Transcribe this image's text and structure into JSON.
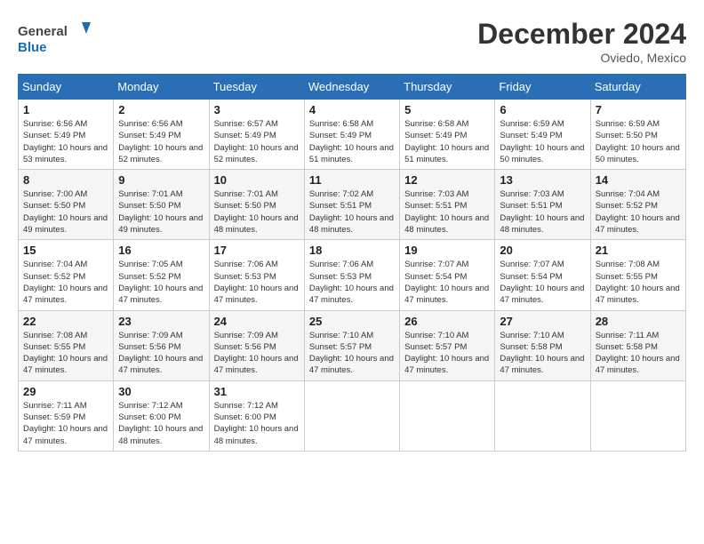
{
  "header": {
    "logo_line1": "General",
    "logo_line2": "Blue",
    "month": "December 2024",
    "location": "Oviedo, Mexico"
  },
  "weekdays": [
    "Sunday",
    "Monday",
    "Tuesday",
    "Wednesday",
    "Thursday",
    "Friday",
    "Saturday"
  ],
  "weeks": [
    [
      {
        "day": "1",
        "sunrise": "6:56 AM",
        "sunset": "5:49 PM",
        "daylight": "10 hours and 53 minutes."
      },
      {
        "day": "2",
        "sunrise": "6:56 AM",
        "sunset": "5:49 PM",
        "daylight": "10 hours and 52 minutes."
      },
      {
        "day": "3",
        "sunrise": "6:57 AM",
        "sunset": "5:49 PM",
        "daylight": "10 hours and 52 minutes."
      },
      {
        "day": "4",
        "sunrise": "6:58 AM",
        "sunset": "5:49 PM",
        "daylight": "10 hours and 51 minutes."
      },
      {
        "day": "5",
        "sunrise": "6:58 AM",
        "sunset": "5:49 PM",
        "daylight": "10 hours and 51 minutes."
      },
      {
        "day": "6",
        "sunrise": "6:59 AM",
        "sunset": "5:49 PM",
        "daylight": "10 hours and 50 minutes."
      },
      {
        "day": "7",
        "sunrise": "6:59 AM",
        "sunset": "5:50 PM",
        "daylight": "10 hours and 50 minutes."
      }
    ],
    [
      {
        "day": "8",
        "sunrise": "7:00 AM",
        "sunset": "5:50 PM",
        "daylight": "10 hours and 49 minutes."
      },
      {
        "day": "9",
        "sunrise": "7:01 AM",
        "sunset": "5:50 PM",
        "daylight": "10 hours and 49 minutes."
      },
      {
        "day": "10",
        "sunrise": "7:01 AM",
        "sunset": "5:50 PM",
        "daylight": "10 hours and 48 minutes."
      },
      {
        "day": "11",
        "sunrise": "7:02 AM",
        "sunset": "5:51 PM",
        "daylight": "10 hours and 48 minutes."
      },
      {
        "day": "12",
        "sunrise": "7:03 AM",
        "sunset": "5:51 PM",
        "daylight": "10 hours and 48 minutes."
      },
      {
        "day": "13",
        "sunrise": "7:03 AM",
        "sunset": "5:51 PM",
        "daylight": "10 hours and 48 minutes."
      },
      {
        "day": "14",
        "sunrise": "7:04 AM",
        "sunset": "5:52 PM",
        "daylight": "10 hours and 47 minutes."
      }
    ],
    [
      {
        "day": "15",
        "sunrise": "7:04 AM",
        "sunset": "5:52 PM",
        "daylight": "10 hours and 47 minutes."
      },
      {
        "day": "16",
        "sunrise": "7:05 AM",
        "sunset": "5:52 PM",
        "daylight": "10 hours and 47 minutes."
      },
      {
        "day": "17",
        "sunrise": "7:06 AM",
        "sunset": "5:53 PM",
        "daylight": "10 hours and 47 minutes."
      },
      {
        "day": "18",
        "sunrise": "7:06 AM",
        "sunset": "5:53 PM",
        "daylight": "10 hours and 47 minutes."
      },
      {
        "day": "19",
        "sunrise": "7:07 AM",
        "sunset": "5:54 PM",
        "daylight": "10 hours and 47 minutes."
      },
      {
        "day": "20",
        "sunrise": "7:07 AM",
        "sunset": "5:54 PM",
        "daylight": "10 hours and 47 minutes."
      },
      {
        "day": "21",
        "sunrise": "7:08 AM",
        "sunset": "5:55 PM",
        "daylight": "10 hours and 47 minutes."
      }
    ],
    [
      {
        "day": "22",
        "sunrise": "7:08 AM",
        "sunset": "5:55 PM",
        "daylight": "10 hours and 47 minutes."
      },
      {
        "day": "23",
        "sunrise": "7:09 AM",
        "sunset": "5:56 PM",
        "daylight": "10 hours and 47 minutes."
      },
      {
        "day": "24",
        "sunrise": "7:09 AM",
        "sunset": "5:56 PM",
        "daylight": "10 hours and 47 minutes."
      },
      {
        "day": "25",
        "sunrise": "7:10 AM",
        "sunset": "5:57 PM",
        "daylight": "10 hours and 47 minutes."
      },
      {
        "day": "26",
        "sunrise": "7:10 AM",
        "sunset": "5:57 PM",
        "daylight": "10 hours and 47 minutes."
      },
      {
        "day": "27",
        "sunrise": "7:10 AM",
        "sunset": "5:58 PM",
        "daylight": "10 hours and 47 minutes."
      },
      {
        "day": "28",
        "sunrise": "7:11 AM",
        "sunset": "5:58 PM",
        "daylight": "10 hours and 47 minutes."
      }
    ],
    [
      {
        "day": "29",
        "sunrise": "7:11 AM",
        "sunset": "5:59 PM",
        "daylight": "10 hours and 47 minutes."
      },
      {
        "day": "30",
        "sunrise": "7:12 AM",
        "sunset": "6:00 PM",
        "daylight": "10 hours and 48 minutes."
      },
      {
        "day": "31",
        "sunrise": "7:12 AM",
        "sunset": "6:00 PM",
        "daylight": "10 hours and 48 minutes."
      },
      null,
      null,
      null,
      null
    ]
  ]
}
